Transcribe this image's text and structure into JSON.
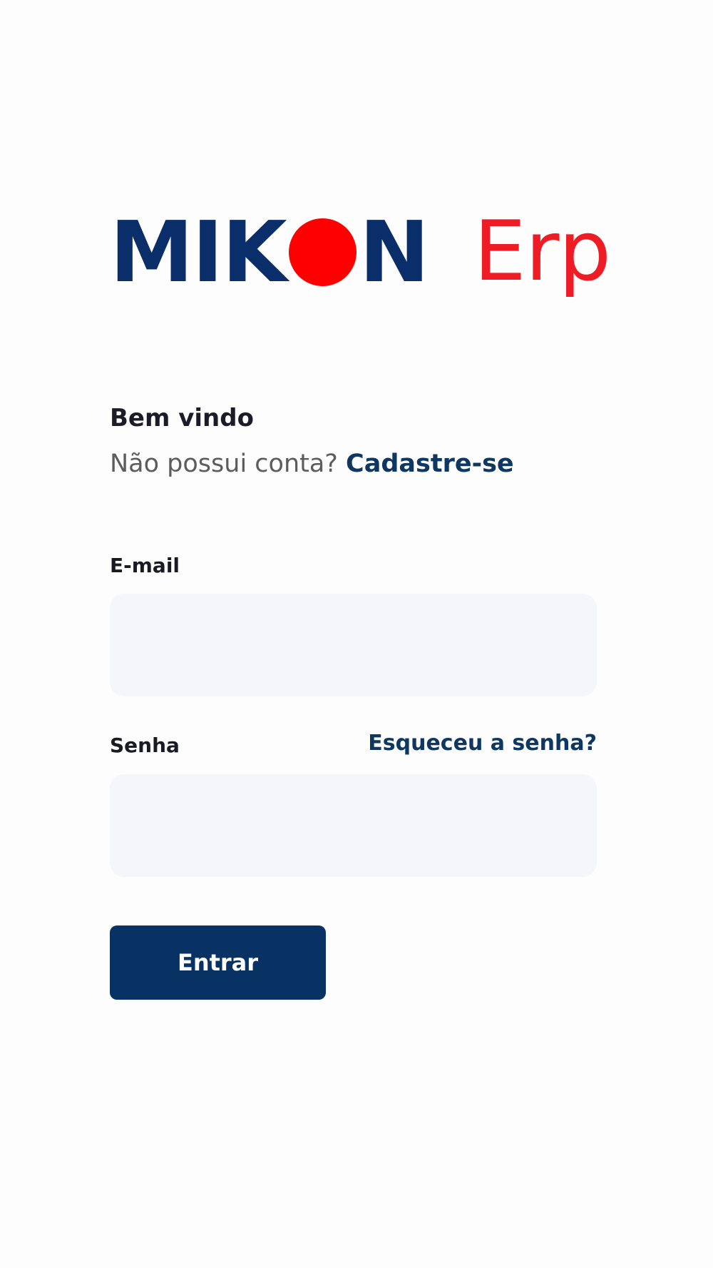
{
  "logo": {
    "name_prefix": "MIK",
    "name_suffix": "N",
    "product": "Erp",
    "colors": {
      "primary": "#0a2e6a",
      "accent": "#ff0000",
      "product": "#ee1c25"
    }
  },
  "welcome": {
    "title": "Bem vindo",
    "no_account_text": "Não possui conta?",
    "signup_link": "Cadastre-se"
  },
  "form": {
    "email": {
      "label": "E-mail",
      "value": "",
      "placeholder": ""
    },
    "password": {
      "label": "Senha",
      "value": "",
      "placeholder": ""
    },
    "forgot_link": "Esqueceu a senha?",
    "submit_label": "Entrar"
  },
  "colors": {
    "background": "#fdfdfd",
    "field_background": "#f4f6f9",
    "button": "#073263",
    "link": "#0e3761"
  }
}
